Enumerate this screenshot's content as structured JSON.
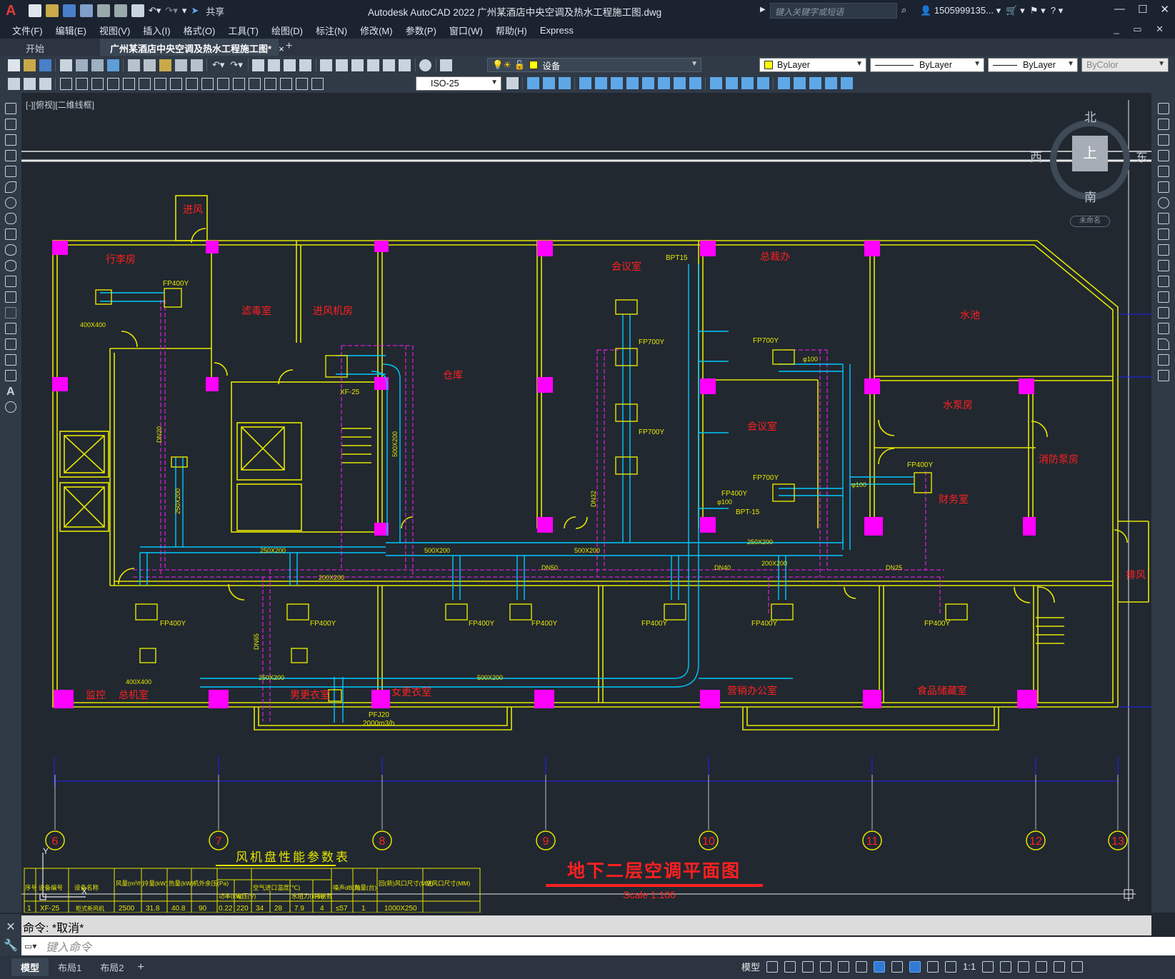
{
  "titlebar": {
    "app_logo": "A",
    "share": "共享",
    "title": "Autodesk AutoCAD 2022    广州某酒店中央空调及热水工程施工图.dwg",
    "search_placeholder": "键入关键字或短语",
    "user": "1505999135...",
    "help": "?"
  },
  "menu": [
    "文件(F)",
    "编辑(E)",
    "视图(V)",
    "插入(I)",
    "格式(O)",
    "工具(T)",
    "绘图(D)",
    "标注(N)",
    "修改(M)",
    "参数(P)",
    "窗口(W)",
    "帮助(H)",
    "Express"
  ],
  "tabs": {
    "start": "开始",
    "active": "广州某酒店中央空调及热水工程施工图*",
    "close": "×",
    "add": "+"
  },
  "toolbar": {
    "layer": "设备",
    "color": "ByLayer",
    "linetype": "ByLayer",
    "lineweight": "ByLayer",
    "plotstyle": "ByColor",
    "dimstyle": "ISO-25"
  },
  "viewport_label": "[-][俯视][二维线框]",
  "viewcube": {
    "north": "北",
    "south": "南",
    "west": "西",
    "east": "东",
    "face": "上",
    "wcs": "未命名"
  },
  "drawing": {
    "rooms": [
      "进风",
      "行李房",
      "滤毒室",
      "进风机房",
      "仓库",
      "会议室",
      "总裁办",
      "水池",
      "水泵房",
      "会议室",
      "消防泵房",
      "财务室",
      "排风",
      "监控",
      "总机室",
      "男更衣室",
      "女更衣室",
      "营销办公室",
      "食品储藏室"
    ],
    "equipment": [
      "FP400Y",
      "FP700Y",
      "FP700Y",
      "FP700Y",
      "FP700Y",
      "FP400Y",
      "FP400Y",
      "FP400Y",
      "FP400Y",
      "FP400Y",
      "FP400Y",
      "FP400Y",
      "FP400Y",
      "FP400Y",
      "XF-25",
      "PFJ20",
      "2000m3/h",
      "BPT15",
      "BPT-15"
    ],
    "dims": [
      "400X400",
      "250X200",
      "500X200",
      "500X200",
      "500X200",
      "250X200",
      "200X200",
      "200X200",
      "400X400",
      "250X200",
      "500X200",
      "250X200",
      "DN50",
      "DN40",
      "DN25",
      "DN65",
      "DN32",
      "DN20",
      "φ100",
      "φ100",
      "φ100"
    ],
    "axes": [
      "6",
      "7",
      "8",
      "9",
      "10",
      "11",
      "12",
      "13"
    ],
    "table_title": "风机盘性能参数表",
    "table_headers": [
      "序号",
      "设备编号",
      "设备名称",
      "风量(m³/h)",
      "冷量(kW)",
      "热量(kW)",
      "机外余压(Pa)",
      "功率(kW)",
      "电压(V)",
      "空气进口温度(℃)",
      "水阻力(kPa)",
      "排管数",
      "噪声dB(A)",
      "数量(台)",
      "回(新)风口尺寸(MM)",
      "送风口尺寸(MM)"
    ],
    "table_row": [
      "1",
      "XF-25",
      "柜式新风机",
      "2500",
      "31.8",
      "40.8",
      "90",
      "0.22",
      "220",
      "34",
      "28",
      "7.9",
      "4",
      "≤57",
      "1",
      "1000X250",
      ""
    ],
    "plan_title": "地下二层空调平面图",
    "plan_scale": "Scale 1:100"
  },
  "command": {
    "history": "命令:  *取消*",
    "placeholder": "键入命令"
  },
  "status": {
    "layouts": [
      "模型",
      "布局1",
      "布局2"
    ],
    "add": "+",
    "model": "模型",
    "scale": "1:1"
  },
  "colors": {
    "wall": "#e6e600",
    "column": "#ff00ff",
    "duct": "#00c8ff",
    "pipe": "#d020d0",
    "text": "#ff2020",
    "grid": "#2020ff"
  }
}
